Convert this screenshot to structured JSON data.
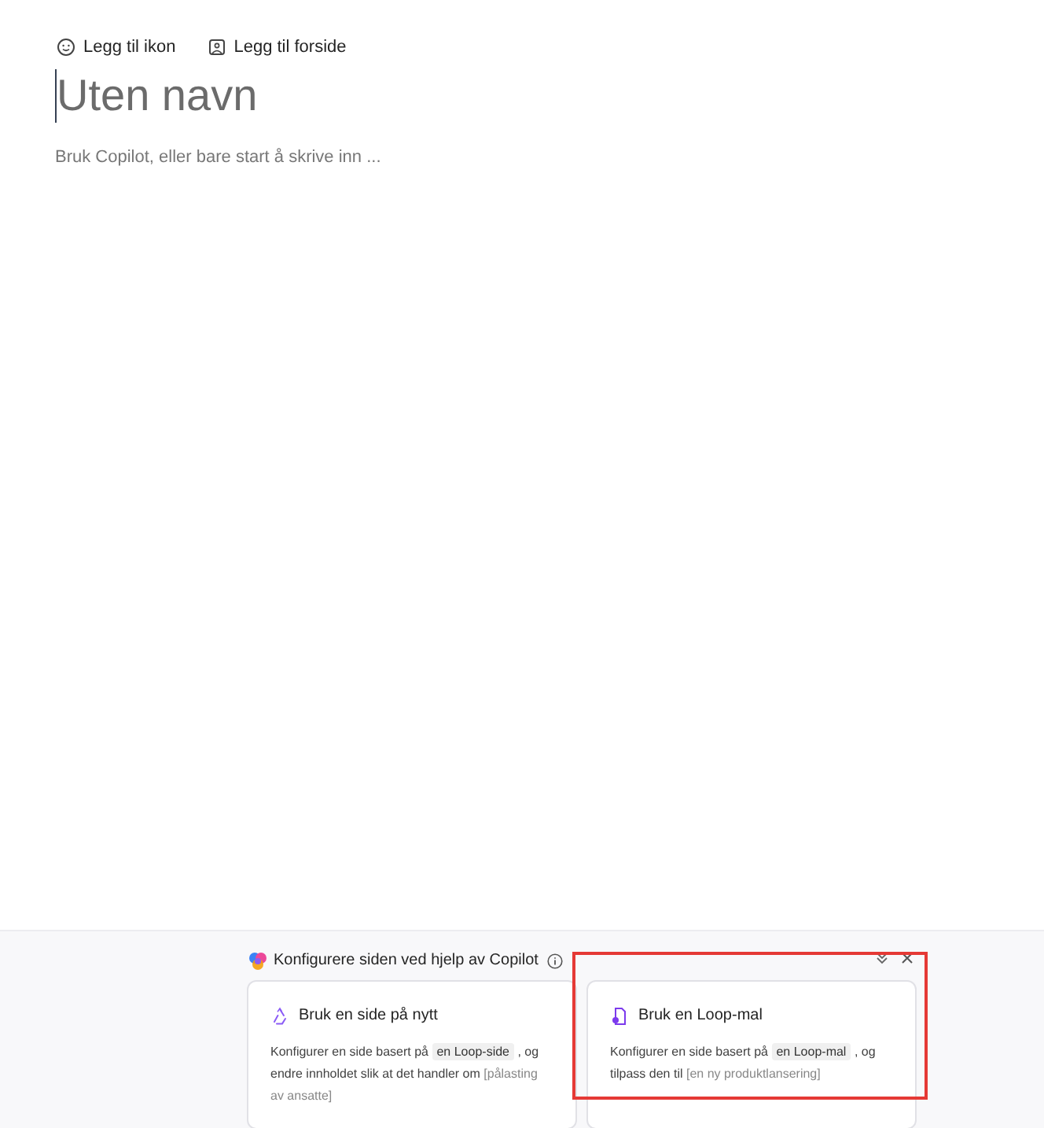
{
  "toolbar": [
    {
      "kind": "icon",
      "label": "Legg til ikon"
    },
    {
      "kind": "cover",
      "label": "Legg til forside"
    }
  ],
  "title": {
    "placeholder": "Uten navn"
  },
  "body": {
    "placeholder": "Bruk Copilot, eller bare start å skrive inn ..."
  },
  "copilot_panel": {
    "heading": "Konfigurere siden ved hjelp av Copilot",
    "cards": [
      {
        "kind": "reuse",
        "title": "Bruk en side på nytt",
        "highlighted": false,
        "segments": [
          {
            "kind": "text",
            "text": "Konfigurer en side basert på "
          },
          {
            "kind": "chip",
            "text": "en Loop-side"
          },
          {
            "kind": "text",
            "text": " , og endre innholdet slik at det handler om "
          },
          {
            "kind": "hint",
            "text": "[pålasting av ansatte]"
          }
        ]
      },
      {
        "kind": "template",
        "title": "Bruk en Loop-mal",
        "highlighted": true,
        "segments": [
          {
            "kind": "text",
            "text": "Konfigurer en side basert på "
          },
          {
            "kind": "chip",
            "text": "en Loop-mal"
          },
          {
            "kind": "text",
            "text": " , og tilpass den til "
          },
          {
            "kind": "hint",
            "text": "[en ny produktlansering]"
          }
        ]
      }
    ]
  }
}
